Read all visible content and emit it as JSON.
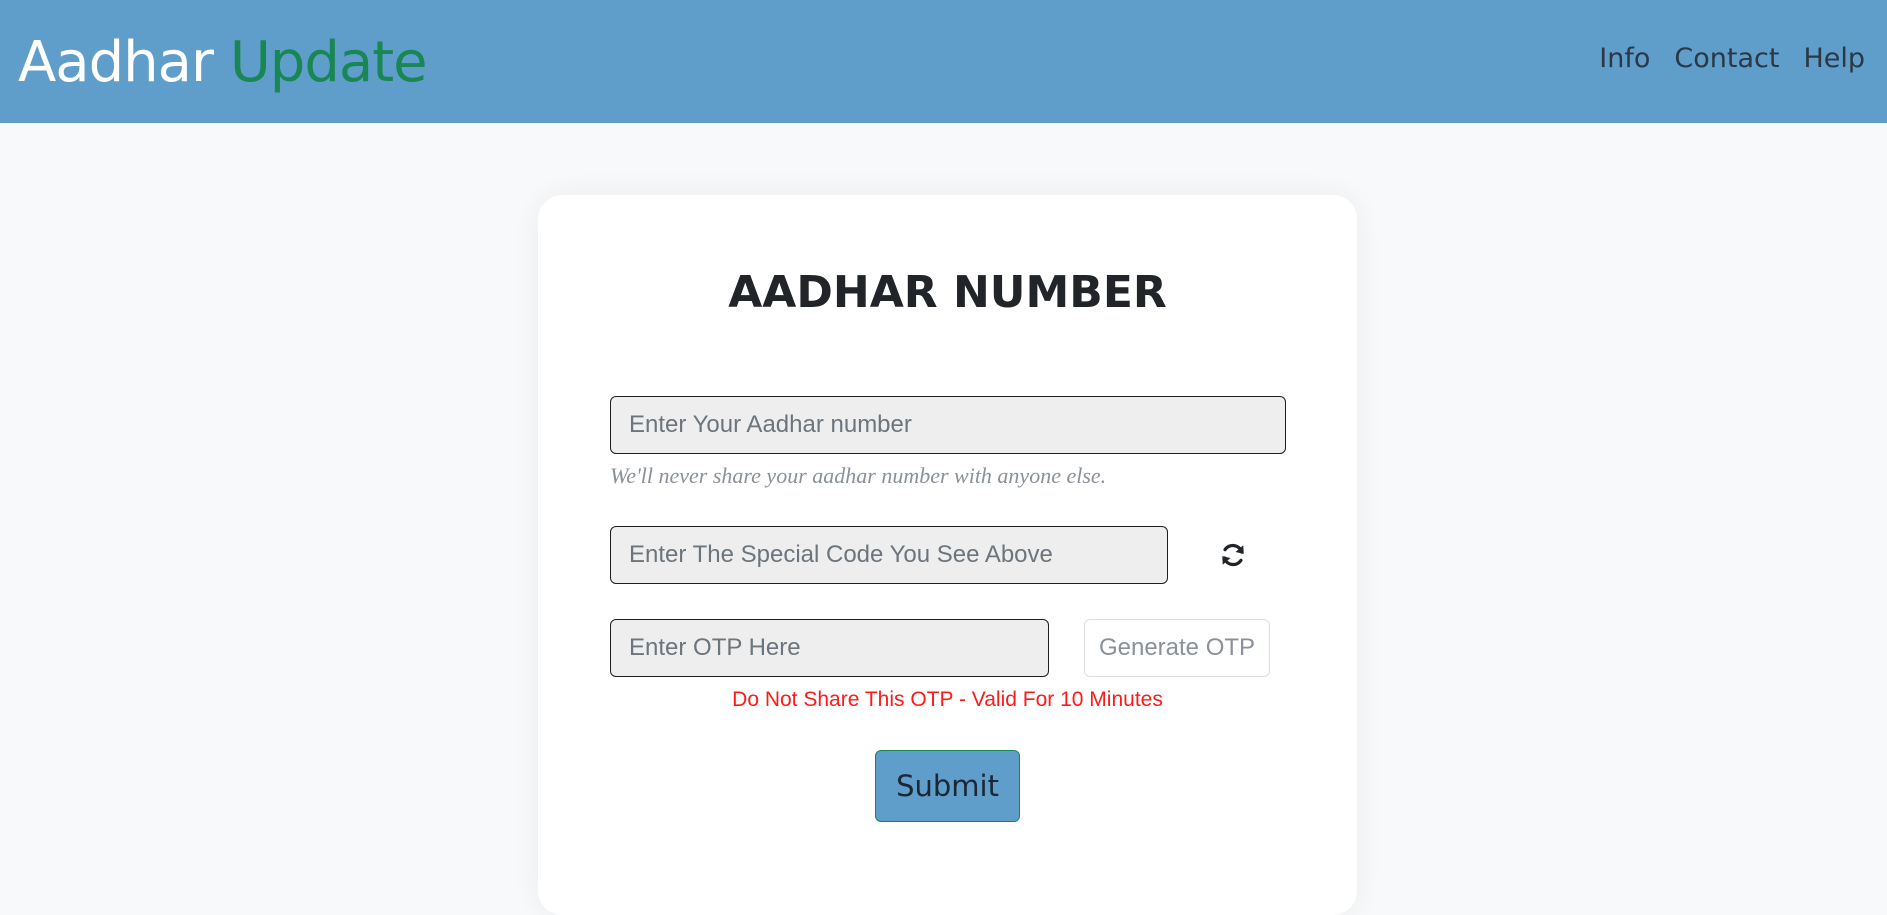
{
  "navbar": {
    "brand_part1": "Aadhar ",
    "brand_part2": "Update",
    "links": [
      {
        "label": "Info"
      },
      {
        "label": "Contact"
      },
      {
        "label": "Help"
      }
    ],
    "background": "#5f9ecb",
    "brand_accent": "#198754"
  },
  "form": {
    "title": "AADHAR NUMBER",
    "aadhar_placeholder": "Enter Your Aadhar number",
    "aadhar_help": "We'll never share your aadhar number with anyone else.",
    "code_placeholder": "Enter The Special Code You See Above",
    "refresh_icon": "refresh-icon",
    "otp_placeholder": "Enter OTP Here",
    "generate_label": "Generate OTP",
    "otp_warning": "Do Not Share This OTP - Valid For 10 Minutes",
    "submit_label": "Submit",
    "warning_color": "#ff1a1a"
  }
}
